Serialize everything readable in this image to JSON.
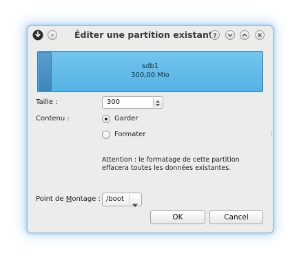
{
  "window": {
    "title": "Éditer une partition existante"
  },
  "titlebar": {
    "menu_icon": "kde-window-menu-icon",
    "pin_icon": "pin-icon",
    "help_icon": "help-icon",
    "minimize_icon": "minimize-icon",
    "maximize_icon": "maximize-icon",
    "close_icon": "close-icon"
  },
  "partition": {
    "name": "sdb1",
    "size": "300,00 Mio"
  },
  "form": {
    "size_label": "Taille :",
    "size_value": "300",
    "content_label": "Contenu :",
    "options": [
      {
        "label": "Garder",
        "selected": true
      },
      {
        "label": "Formater",
        "selected": false
      }
    ],
    "warning": "Attention : le formatage de cette partition effacera toutes les données existantes.",
    "mount_label_pre": "Point de ",
    "mount_label_accel": "M",
    "mount_label_post": "ontage :",
    "mount_value": "/boot"
  },
  "buttons": {
    "ok": "OK",
    "cancel": "Cancel"
  },
  "colors": {
    "partition_fill": "#5ab8e6",
    "window_bg": "#ececea",
    "glow": "#7cc4ee"
  }
}
